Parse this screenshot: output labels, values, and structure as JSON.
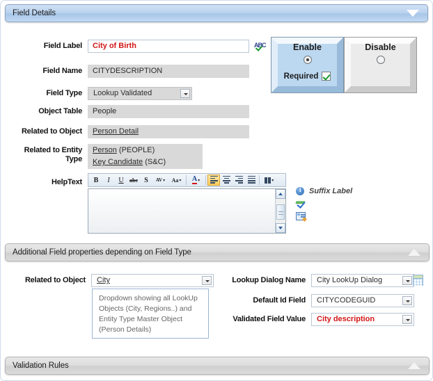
{
  "sections": {
    "field_details": {
      "title": "Field Details",
      "chevron": "chevron-down-icon"
    },
    "additional": {
      "title": "Additional Field properties depending on Field Type",
      "chevron": "chevron-up-icon"
    },
    "validation": {
      "title": "Validation Rules",
      "chevron": "chevron-up-icon"
    }
  },
  "field_details": {
    "field_label": {
      "label": "Field Label",
      "value": "City of Birth",
      "value_color": "#d31616"
    },
    "field_name": {
      "label": "Field Name",
      "value": "CITYDESCRIPTION"
    },
    "field_type": {
      "label": "Field Type",
      "value": "Lookup Validated"
    },
    "object_table": {
      "label": "Object Table",
      "value": "People"
    },
    "related_to_object": {
      "label": "Related to Object",
      "value": "Person Detail"
    },
    "related_entity_type": {
      "label_line1": "Related to  Entity",
      "label_line2": "Type",
      "rows": [
        {
          "link": "Person",
          "suffix": " (PEOPLE)"
        },
        {
          "link": "Key Candidate",
          "suffix": " (S&C)"
        }
      ]
    },
    "help_text": {
      "label": "HelpText",
      "value": ""
    }
  },
  "toggle": {
    "enable": {
      "label": "Enable",
      "selected": true
    },
    "disable": {
      "label": "Disable",
      "selected": false
    },
    "required": {
      "label": "Required",
      "checked": true
    }
  },
  "editor_toolbar": {
    "buttons": [
      {
        "name": "bold-icon",
        "glyph": "B"
      },
      {
        "name": "italic-icon",
        "glyph": "I"
      },
      {
        "name": "underline-icon",
        "glyph": "U"
      },
      {
        "name": "strikethrough-icon",
        "glyph": "abc"
      },
      {
        "name": "shadow-text-icon",
        "glyph": "S"
      },
      {
        "name": "character-spacing-icon",
        "glyph": "AV"
      },
      {
        "name": "change-case-icon",
        "glyph": "Aa"
      },
      {
        "name": "font-color-icon",
        "glyph": "A"
      },
      {
        "name": "align-left-icon",
        "glyph": ""
      },
      {
        "name": "align-center-icon",
        "glyph": ""
      },
      {
        "name": "align-right-icon",
        "glyph": ""
      },
      {
        "name": "align-justify-icon",
        "glyph": ""
      },
      {
        "name": "columns-icon",
        "glyph": ""
      }
    ]
  },
  "suffix": {
    "label": "Suffix Label",
    "icons": [
      "info-icon",
      "spellcheck-icon",
      "form-edit-icon"
    ]
  },
  "spellcheck_icon": {
    "name": "spellcheck-icon",
    "glyph": "ABC"
  },
  "additional_properties": {
    "related_to_object": {
      "label": "Related to Object",
      "value": "City"
    },
    "dropdown_hint": "Dropdown showing all LookUp Objects (City, Regions..) and Entity Type Master Object (Person Details)",
    "lookup_dialog_name": {
      "label": "Lookup Dialog Name",
      "value": "City LookUp Dialog"
    },
    "default_id_field": {
      "label": "Default Id Field",
      "value": "CITYCODEGUID"
    },
    "validated_field_value": {
      "label": "Validated Field Value",
      "value": "City description",
      "value_color": "#d31616"
    },
    "grid_button": "table-picker-icon"
  },
  "colors": {
    "header_blue": "#bcd4ef",
    "header_grey": "#dedede",
    "accent_red": "#d31616",
    "readonly_grey": "#d9d9d9",
    "enable_blue": "#bcd8f0"
  }
}
